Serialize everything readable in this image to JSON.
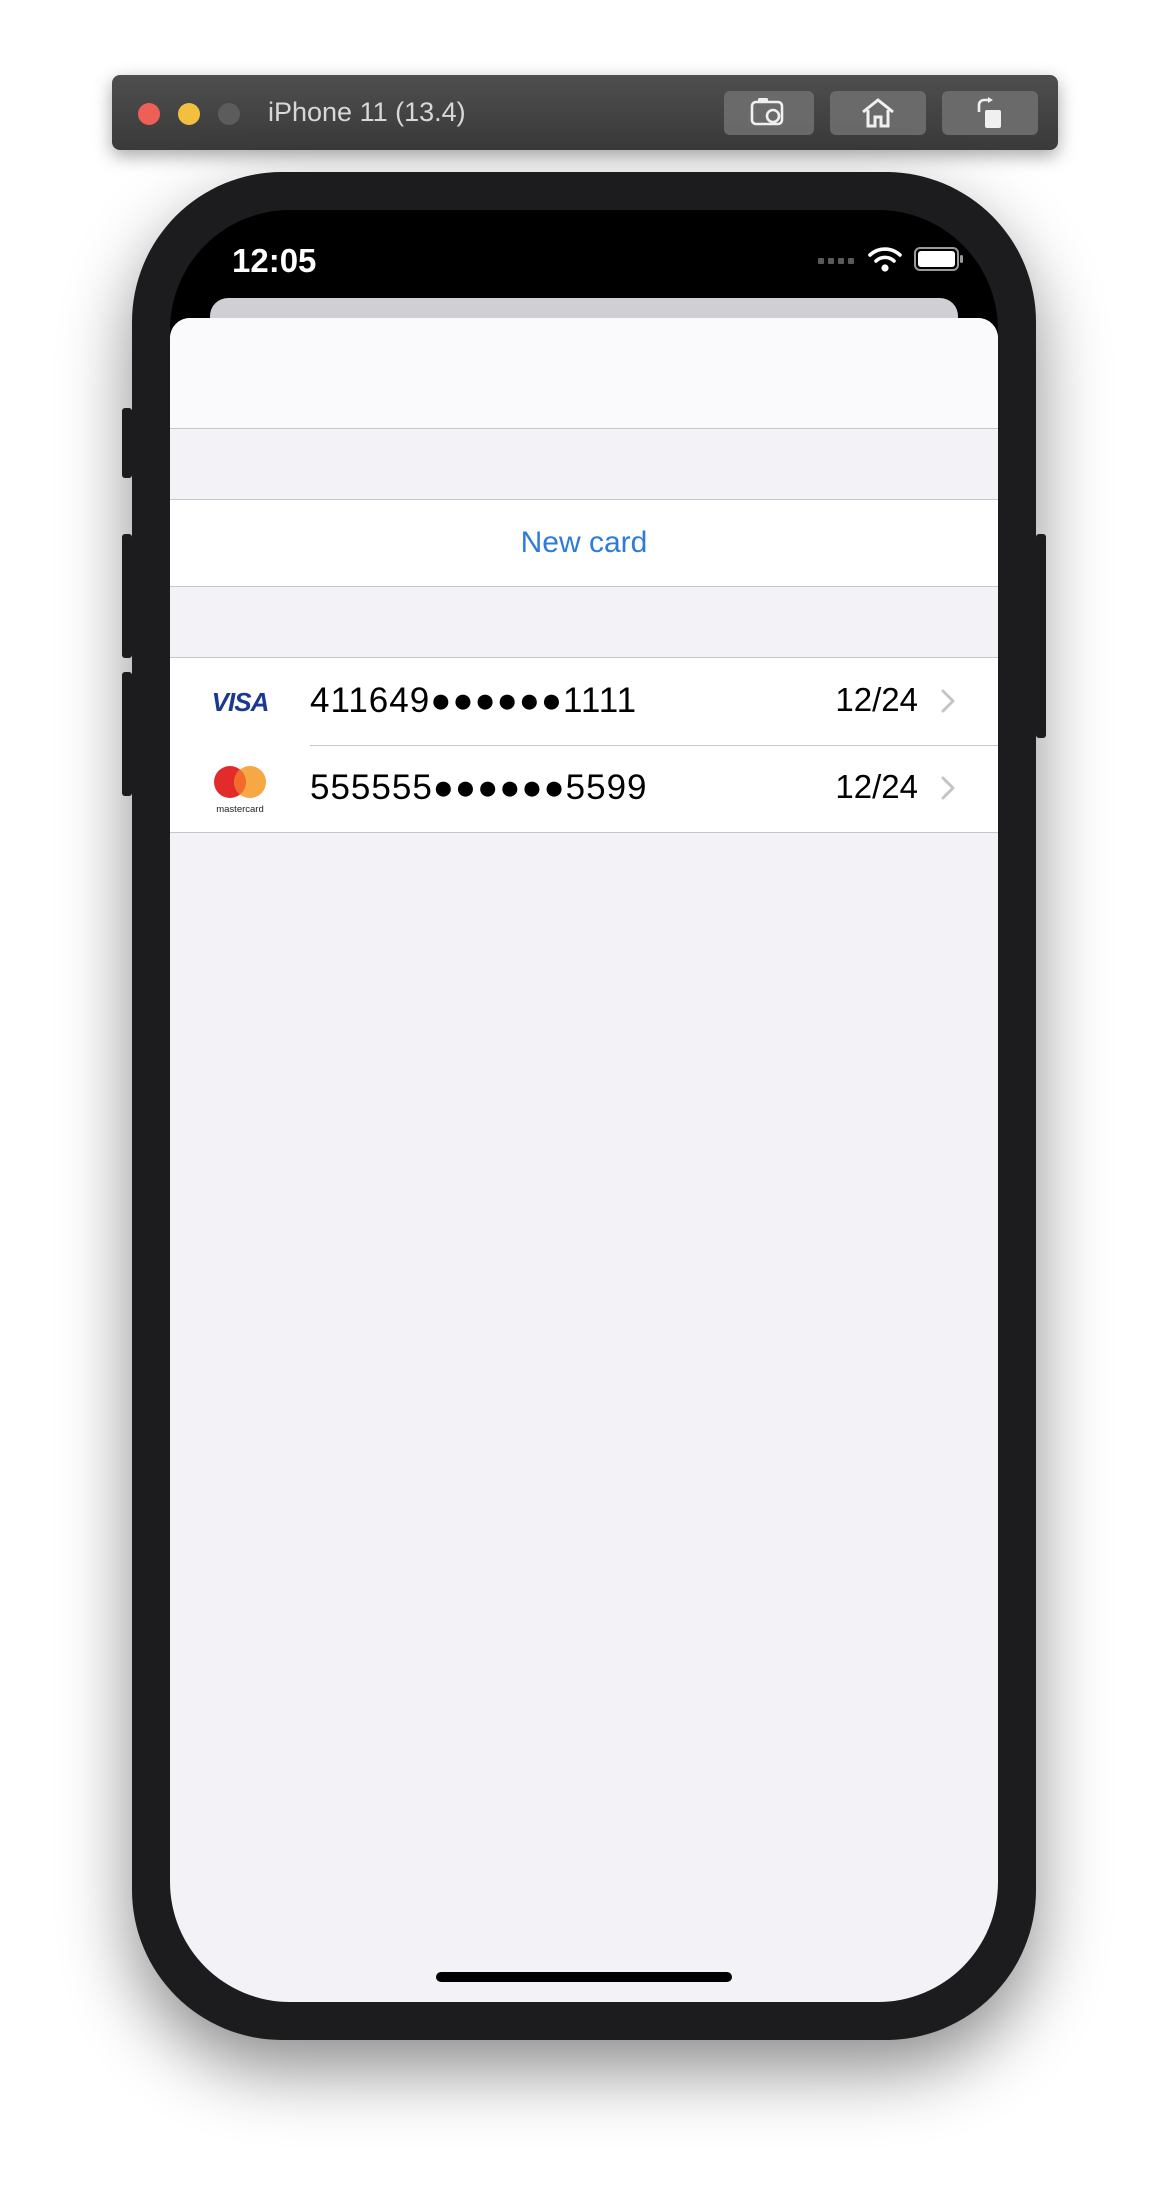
{
  "simulator": {
    "title": "iPhone 11 (13.4)",
    "buttons": [
      "screenshot-icon",
      "home-icon",
      "rotate-icon"
    ],
    "traffic_colors": [
      "#ee5f57",
      "#f2bf3f",
      "#5c5c5c"
    ]
  },
  "status_bar": {
    "time": "12:05",
    "icons": [
      "signal-icon",
      "wifi-icon",
      "battery-icon"
    ]
  },
  "actions": {
    "new_card_label": "New card",
    "accent_color": "#2f7bd8"
  },
  "cards": [
    {
      "brand": "VISA",
      "brand_icon": "visa-logo",
      "number": "411649●●●●●●1111",
      "expiry": "12/24"
    },
    {
      "brand": "mastercard",
      "brand_icon": "mastercard-logo",
      "number": "555555●●●●●●5599",
      "expiry": "12/24"
    }
  ]
}
